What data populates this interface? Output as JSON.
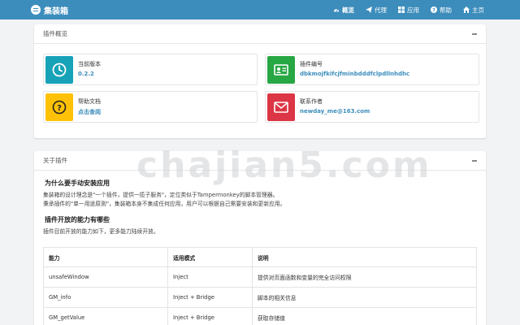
{
  "app": {
    "name": "集装箱"
  },
  "nav": [
    {
      "key": "overview",
      "label": "概览",
      "icon": "dashboard-icon"
    },
    {
      "key": "proxy",
      "label": "代理",
      "icon": "send-icon"
    },
    {
      "key": "apps",
      "label": "应用",
      "icon": "windows-icon"
    },
    {
      "key": "help",
      "label": "帮助",
      "icon": "question-circle-icon"
    },
    {
      "key": "home",
      "label": "主页",
      "icon": "home-icon"
    }
  ],
  "overview": {
    "title": "插件概览",
    "cards": [
      {
        "key": "version",
        "label": "当前版本",
        "value": "0.2.2",
        "color": "#17a2b8",
        "icon": "clock-icon"
      },
      {
        "key": "id",
        "label": "插件编号",
        "value": "dbkmojfkifcjfminbdddfclpdllnhdhc",
        "color": "#28a745",
        "icon": "id-card-icon"
      },
      {
        "key": "docs",
        "label": "帮助文档",
        "value": "点击查阅",
        "color": "#ffc107",
        "icon": "question-icon"
      },
      {
        "key": "contact",
        "label": "联系作者",
        "value": "newday_me@163.com",
        "color": "#dc3545",
        "icon": "envelope-icon"
      }
    ]
  },
  "about": {
    "title": "关于插件",
    "sec1_title": "为什么要手动安装应用",
    "sec1_line1": "集装箱的设计理念是\"一个插件，提供一揽子服务\"，定位类似于Tampermonkey的脚本管理器。",
    "sec1_line2": "秉承插件的\"单一用途原则\"，集装箱本身不集成任何应用，用户可以根据自己需要安装和更新应用。",
    "sec2_title": "插件开放的能力有哪些",
    "sec2_line1": "插件目前开放的能力如下，更多能力陆续开放。",
    "table": {
      "headers": [
        "能力",
        "适用模式",
        "说明"
      ],
      "rows": [
        [
          "unsafeWindow",
          "Inject",
          "提供对页面函数和变量的完全访问权限"
        ],
        [
          "GM_info",
          "Inject + Bridge",
          "脚本的相关信息"
        ],
        [
          "GM_getValue",
          "Inject + Bridge",
          "获取存储值"
        ]
      ]
    }
  },
  "watermark": "chajian5.com",
  "colors": {
    "topbar": "#3c8dbc",
    "link": "#3c8dbc"
  }
}
